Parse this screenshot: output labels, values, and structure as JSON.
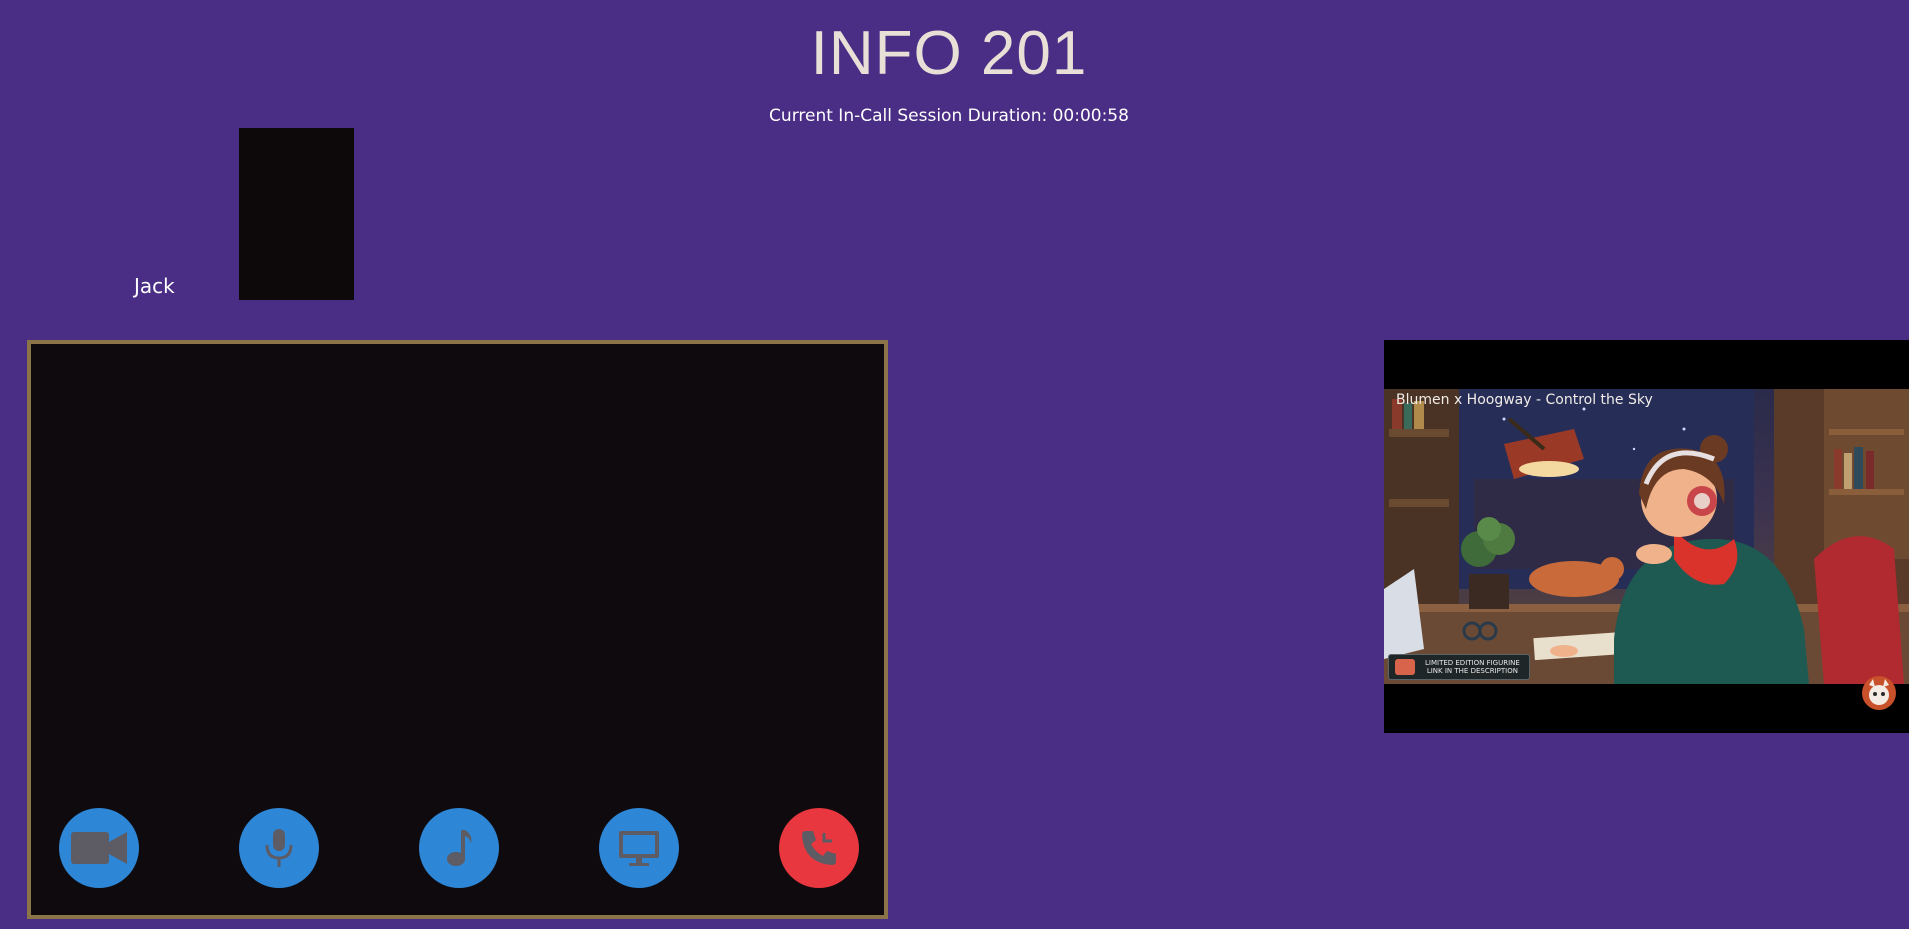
{
  "page": {
    "title": "INFO 201",
    "session_duration": "Current In-Call Session Duration: 00:00:58"
  },
  "participants": [
    {
      "name": "Jack"
    }
  ],
  "controls": [
    {
      "label": "camera",
      "icon": "video-camera-icon",
      "state": "off"
    },
    {
      "label": "microphone",
      "icon": "microphone-icon",
      "state": "on"
    },
    {
      "label": "music",
      "icon": "music-note-icon",
      "state": "on"
    },
    {
      "label": "screen share",
      "icon": "monitor-icon",
      "state": "off"
    },
    {
      "label": "hang up",
      "icon": "phone-hangup-icon",
      "state": "active"
    }
  ],
  "shared_video": {
    "title": "Blumen x Hoogway - Control the Sky",
    "badge_line1": "LIMITED EDITION FIGURINE",
    "badge_line2": "LINK IN THE DESCRIPTION"
  },
  "colors": {
    "background": "#4a2d84",
    "control_blue": "#2e86d6",
    "hangup_red": "#e8373f",
    "main_video_border": "#8a7448"
  }
}
